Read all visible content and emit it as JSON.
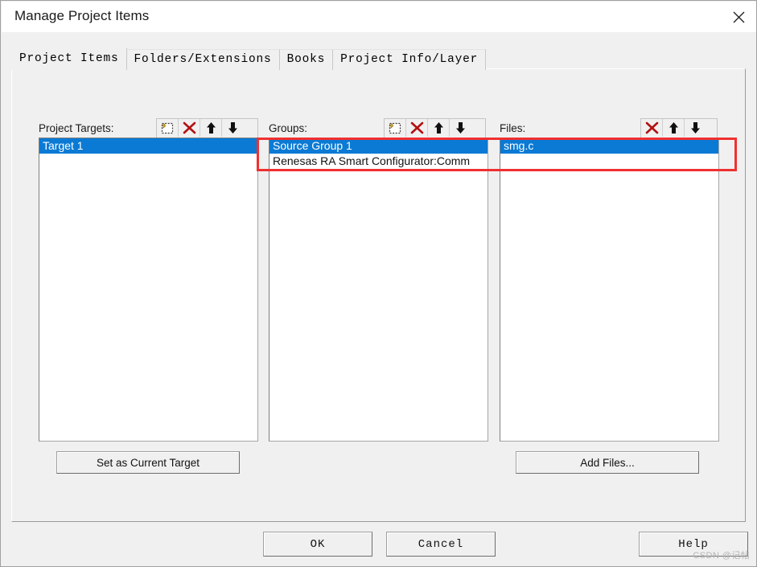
{
  "window": {
    "title": "Manage Project Items",
    "close_icon": "close-icon"
  },
  "tabs": [
    {
      "label": "Project Items",
      "selected": true
    },
    {
      "label": "Folders/Extensions",
      "selected": false
    },
    {
      "label": "Books",
      "selected": false
    },
    {
      "label": "Project Info/Layer",
      "selected": false
    }
  ],
  "columns": {
    "targets": {
      "label": "Project Targets:",
      "tools": [
        "new-item-icon",
        "delete-icon",
        "move-up-icon",
        "move-down-icon"
      ],
      "items": [
        {
          "text": "Target 1",
          "selected": true
        }
      ]
    },
    "groups": {
      "label": "Groups:",
      "tools": [
        "new-item-icon",
        "delete-icon",
        "move-up-icon",
        "move-down-icon"
      ],
      "items": [
        {
          "text": "Source Group 1",
          "selected": true
        },
        {
          "text": "Renesas RA Smart Configurator:Comm",
          "selected": false
        }
      ]
    },
    "files": {
      "label": "Files:",
      "tools": [
        "delete-icon",
        "move-up-icon",
        "move-down-icon"
      ],
      "items": [
        {
          "text": "smg.c",
          "selected": true
        }
      ]
    }
  },
  "actions": {
    "set_current_target": "Set as Current Target",
    "add_files": "Add Files..."
  },
  "dialog_buttons": {
    "ok": "OK",
    "cancel": "Cancel",
    "help": "Help"
  },
  "watermark": "CSDN @记帖",
  "colors": {
    "selection_blue": "#0a7ad4",
    "annotation_red": "#f03030",
    "dialog_face": "#f0f0f0"
  }
}
